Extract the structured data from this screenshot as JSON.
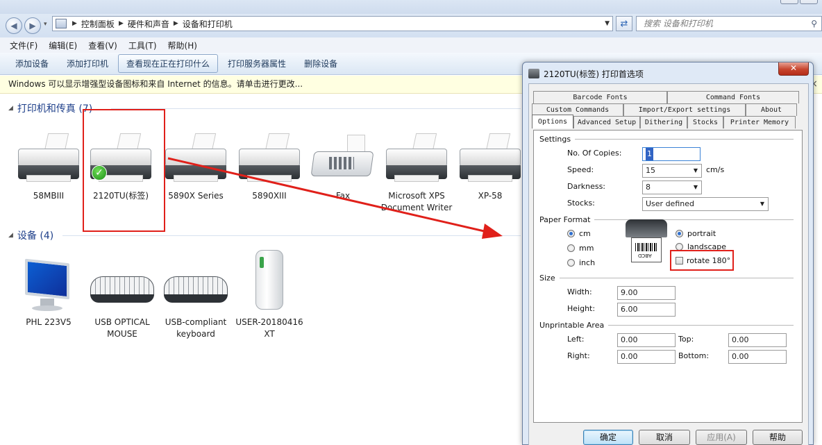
{
  "address": {
    "crumbs": [
      "控制面板",
      "硬件和声音",
      "设备和打印机"
    ],
    "search_placeholder": "搜索 设备和打印机"
  },
  "menu": [
    "文件(F)",
    "编辑(E)",
    "查看(V)",
    "工具(T)",
    "帮助(H)"
  ],
  "toolbar": [
    "添加设备",
    "添加打印机",
    "查看现在正在打印什么",
    "打印服务器属性",
    "删除设备"
  ],
  "infobar": "Windows 可以显示增强型设备图标和来自 Internet 的信息。请单击进行更改...",
  "groups": {
    "printers_title": "打印机和传真 (7)",
    "devices_title": "设备 (4)"
  },
  "printers": [
    {
      "label": "58MBIII"
    },
    {
      "label": "2120TU(标签)",
      "default": true
    },
    {
      "label": "5890X Series"
    },
    {
      "label": "5890XIII"
    },
    {
      "label": "Fax"
    },
    {
      "label": "Microsoft XPS Document Writer"
    },
    {
      "label": "XP-58"
    }
  ],
  "devices": [
    {
      "label": "PHL 223V5"
    },
    {
      "label": "USB OPTICAL MOUSE"
    },
    {
      "label": "USB-compliant keyboard"
    },
    {
      "label": "USER-20180416 XT"
    }
  ],
  "dialog": {
    "title": "2120TU(标签) 打印首选项",
    "tabs_row1": [
      "Barcode Fonts",
      "Command Fonts"
    ],
    "tabs_row2": [
      "Custom Commands",
      "Import/Export settings",
      "About"
    ],
    "tabs_row3": [
      "Options",
      "Advanced Setup",
      "Dithering",
      "Stocks",
      "Printer Memory"
    ],
    "settings": {
      "section": "Settings",
      "copies_label": "No. Of Copies:",
      "copies_value": "1",
      "speed_label": "Speed:",
      "speed_value": "15",
      "speed_unit": "cm/s",
      "darkness_label": "Darkness:",
      "darkness_value": "8",
      "stocks_label": "Stocks:",
      "stocks_value": "User defined"
    },
    "paper_format": {
      "section": "Paper Format",
      "units": [
        "cm",
        "mm",
        "inch"
      ],
      "selected_unit": "cm",
      "orientations": [
        "portrait",
        "landscape"
      ],
      "selected_orientation": "portrait",
      "rotate_label": "rotate 180°",
      "rotate_checked": false,
      "preview_text": "ABCD"
    },
    "size": {
      "section": "Size",
      "width_label": "Width:",
      "width_value": "9.00",
      "height_label": "Height:",
      "height_value": "6.00"
    },
    "unprintable": {
      "section": "Unprintable Area",
      "left_label": "Left:",
      "left_value": "0.00",
      "top_label": "Top:",
      "top_value": "0.00",
      "right_label": "Right:",
      "right_value": "0.00",
      "bottom_label": "Bottom:",
      "bottom_value": "0.00"
    },
    "buttons": {
      "ok": "确定",
      "cancel": "取消",
      "apply": "应用(A)",
      "help": "帮助"
    }
  },
  "annotation_color": "#e0201a"
}
